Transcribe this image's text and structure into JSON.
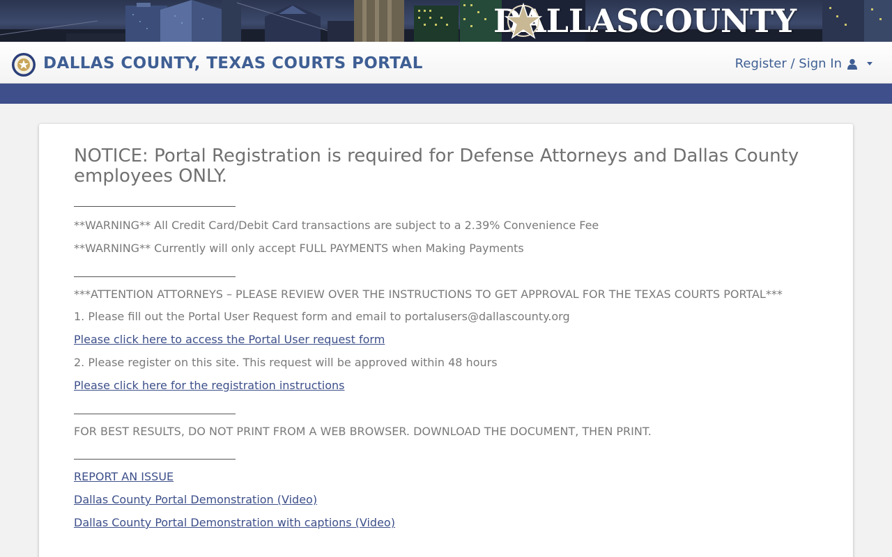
{
  "banner": {
    "title_left": "DALLAS",
    "title_right": "COUNTY"
  },
  "header": {
    "portal_title": "DALLAS COUNTY, TEXAS COURTS PORTAL",
    "signin_label": "Register / Sign In"
  },
  "notice": {
    "heading": "NOTICE: Portal Registration is required for Defense Attorneys and Dallas County employees ONLY.",
    "warning_fee": "**WARNING** All Credit Card/Debit Card transactions are subject to a 2.39% Convenience Fee",
    "warning_full": "**WARNING** Currently will only accept FULL PAYMENTS when Making Payments",
    "attention": "***ATTENTION ATTORNEYS – PLEASE REVIEW OVER THE INSTRUCTIONS TO GET APPROVAL FOR THE TEXAS COURTS PORTAL***",
    "step1": "1. Please fill out the Portal User Request form and email to portalusers@dallascounty.org",
    "link_request_form": "Please click here to access the Portal User request form",
    "step2": "2. Please register on this site. This request will be approved within 48 hours",
    "link_registration": "Please click here for the registration instructions",
    "print_note": "FOR BEST RESULTS, DO NOT PRINT FROM A WEB BROWSER. DOWNLOAD THE DOCUMENT, THEN PRINT.",
    "link_report": "REPORT AN ISSUE",
    "link_demo": "Dallas County Portal Demonstration (Video)",
    "link_demo_captions": "Dallas County Portal Demonstration with captions (Video)"
  },
  "colors": {
    "brand_blue": "#3f5f94",
    "strip_blue": "#3e4f8c",
    "link_blue": "#3d4f8a"
  }
}
